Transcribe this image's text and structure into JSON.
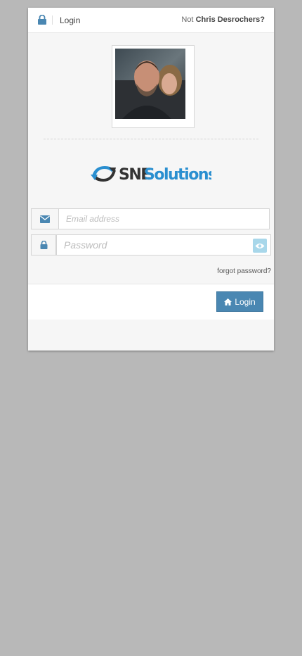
{
  "header": {
    "title": "Login",
    "not_prefix": "Not",
    "user_name": "Chris Desrochers?",
    "lock_icon": "lock-icon"
  },
  "avatar": {
    "alt": "user photo"
  },
  "brand": {
    "sne": "SNE",
    "solutions": "Solutions"
  },
  "form": {
    "email_placeholder": "Email address",
    "email_value": "",
    "password_placeholder": "Password",
    "password_value": "",
    "forgot_label": "forgot password?",
    "login_label": "Login"
  },
  "colors": {
    "accent": "#4a87b2",
    "eye_button": "#a8d7ea",
    "logo_dark": "#333333",
    "logo_blue": "#2a8fd0"
  }
}
